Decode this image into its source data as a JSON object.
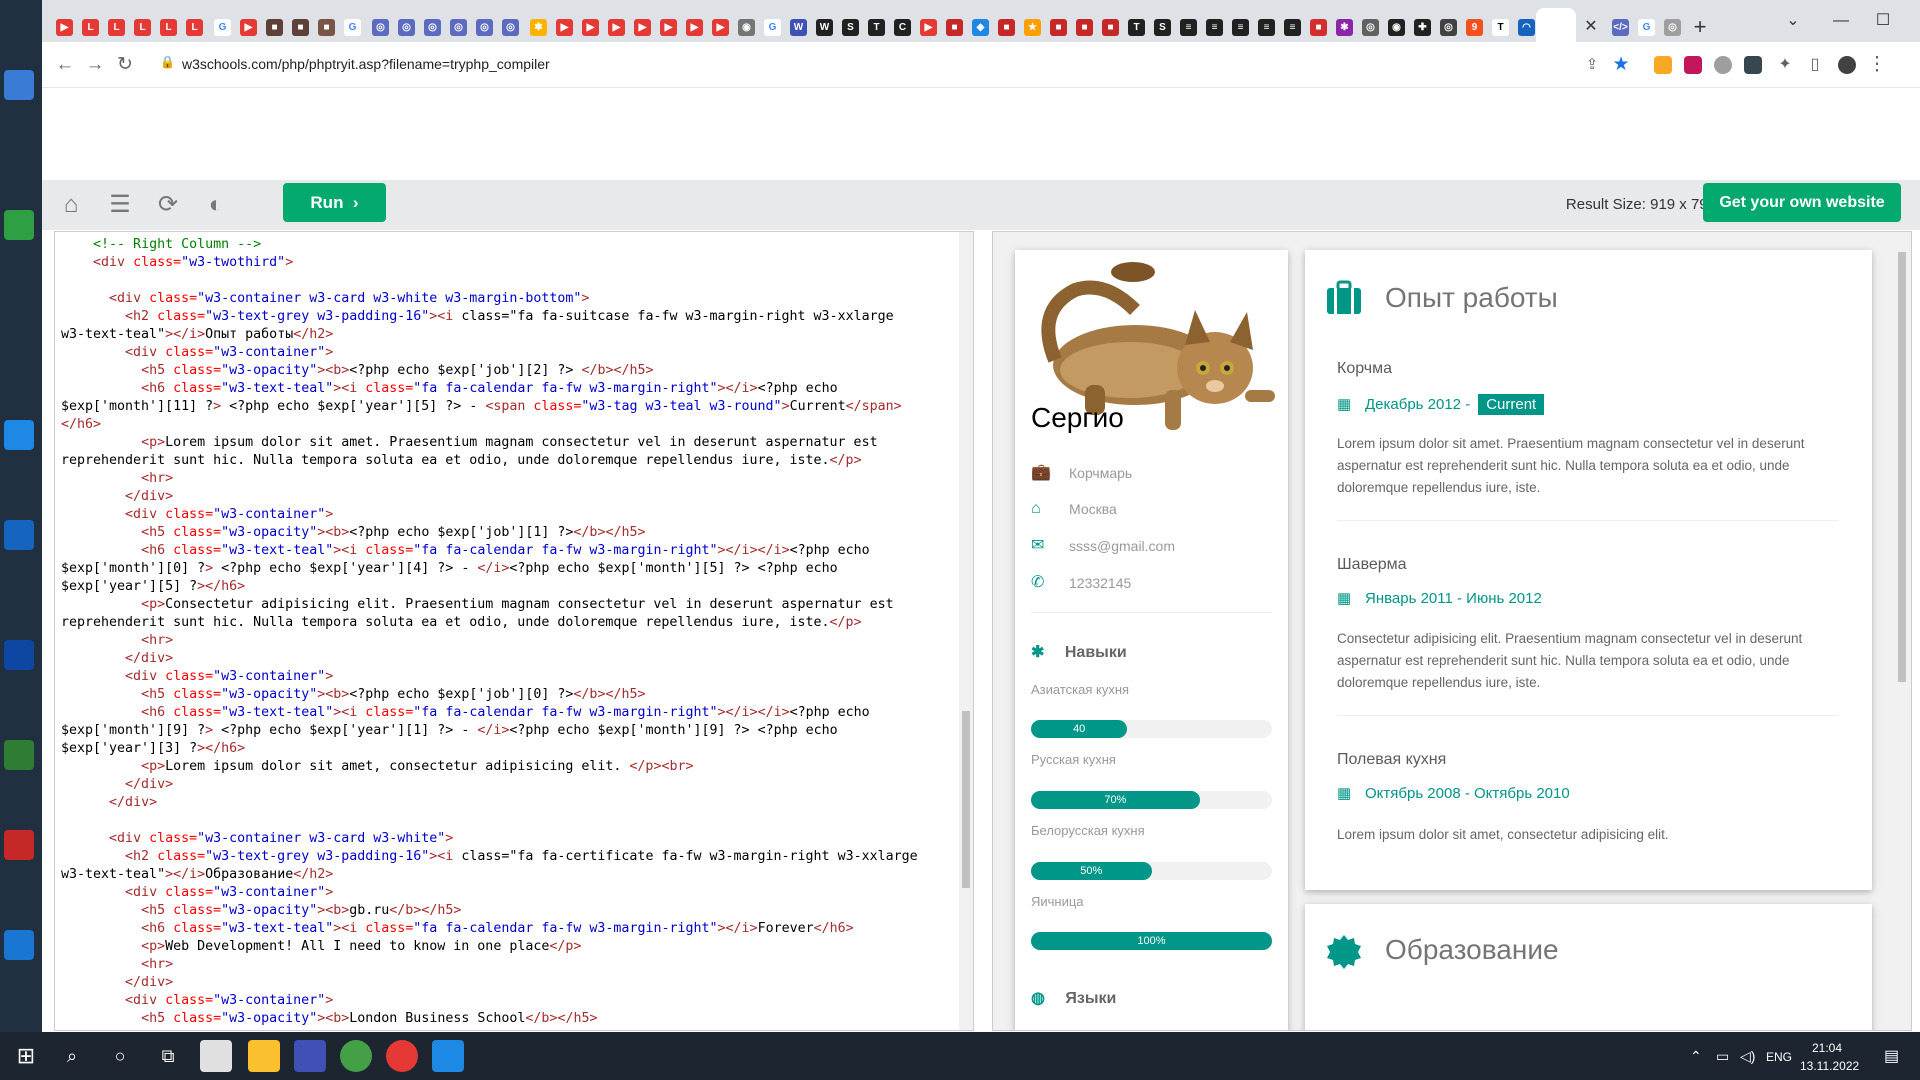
{
  "browser": {
    "url": "w3schools.com/php/phptryit.asp?filename=tryphp_compiler",
    "tab_close": "✕",
    "new_tab": "+"
  },
  "tryit": {
    "run_label": "Run",
    "result_size": "Result Size: 919 x 797",
    "own_site": "Get your own website"
  },
  "code_lines": [
    "    <!-- Right Column -->",
    "    <div class=\"w3-twothird\">",
    "",
    "      <div class=\"w3-container w3-card w3-white w3-margin-bottom\">",
    "        <h2 class=\"w3-text-grey w3-padding-16\"><i class=\"fa fa-suitcase fa-fw w3-margin-right w3-xxlarge",
    "w3-text-teal\"></i>Опыт работы</h2>",
    "        <div class=\"w3-container\">",
    "          <h5 class=\"w3-opacity\"><b><?php echo $exp['job'][2] ?> </b></h5>",
    "          <h6 class=\"w3-text-teal\"><i class=\"fa fa-calendar fa-fw w3-margin-right\"></i><?php echo",
    "$exp['month'][11] ?> <?php echo $exp['year'][5] ?> - <span class=\"w3-tag w3-teal w3-round\">Current</span>",
    "</h6>",
    "          <p>Lorem ipsum dolor sit amet. Praesentium magnam consectetur vel in deserunt aspernatur est",
    "reprehenderit sunt hic. Nulla tempora soluta ea et odio, unde doloremque repellendus iure, iste.</p>",
    "          <hr>",
    "        </div>",
    "        <div class=\"w3-container\">",
    "          <h5 class=\"w3-opacity\"><b><?php echo $exp['job'][1] ?></b></h5>",
    "          <h6 class=\"w3-text-teal\"><i class=\"fa fa-calendar fa-fw w3-margin-right\"></i></i><?php echo",
    "$exp['month'][0] ?> <?php echo $exp['year'][4] ?> - </i><?php echo $exp['month'][5] ?> <?php echo",
    "$exp['year'][5] ?></h6>",
    "          <p>Consectetur adipisicing elit. Praesentium magnam consectetur vel in deserunt aspernatur est",
    "reprehenderit sunt hic. Nulla tempora soluta ea et odio, unde doloremque repellendus iure, iste.</p>",
    "          <hr>",
    "        </div>",
    "        <div class=\"w3-container\">",
    "          <h5 class=\"w3-opacity\"><b><?php echo $exp['job'][0] ?></b></h5>",
    "          <h6 class=\"w3-text-teal\"><i class=\"fa fa-calendar fa-fw w3-margin-right\"></i></i><?php echo",
    "$exp['month'][9] ?> <?php echo $exp['year'][1] ?> - </i><?php echo $exp['month'][9] ?> <?php echo",
    "$exp['year'][3] ?></h6>",
    "          <p>Lorem ipsum dolor sit amet, consectetur adipisicing elit. </p><br>",
    "        </div>",
    "      </div>",
    "",
    "      <div class=\"w3-container w3-card w3-white\">",
    "        <h2 class=\"w3-text-grey w3-padding-16\"><i class=\"fa fa-certificate fa-fw w3-margin-right w3-xxlarge",
    "w3-text-teal\"></i>Образование</h2>",
    "        <div class=\"w3-container\">",
    "          <h5 class=\"w3-opacity\"><b>gb.ru</b></h5>",
    "          <h6 class=\"w3-text-teal\"><i class=\"fa fa-calendar fa-fw w3-margin-right\"></i>Forever</h6>",
    "          <p>Web Development! All I need to know in one place</p>",
    "          <hr>",
    "        </div>",
    "        <div class=\"w3-container\">",
    "          <h5 class=\"w3-opacity\"><b>London Business School</b></h5>"
  ],
  "profile": {
    "name": "Сергио",
    "job": "Корчмарь",
    "city": "Москва",
    "email": "ssss@gmail.com",
    "phone": "12332145",
    "skills_heading": "Навыки",
    "languages_heading": "Языки",
    "skills": [
      {
        "label": "Азиатская кухня",
        "value": "40",
        "fraction": 0.4
      },
      {
        "label": "Русская кухня",
        "value": "70%",
        "fraction": 0.7
      },
      {
        "label": "Белорусская кухня",
        "value": "50%",
        "fraction": 0.5
      },
      {
        "label": "Яичница",
        "value": "100%",
        "fraction": 1.0
      }
    ]
  },
  "experience": {
    "heading": "Опыт работы",
    "jobs": [
      {
        "title": "Корчма",
        "date": "Декабрь 2012 -",
        "tag": "Current",
        "text": "Lorem ipsum dolor sit amet. Praesentium magnam consectetur vel in deserunt aspernatur est reprehenderit sunt hic. Nulla tempora soluta ea et odio, unde doloremque repellendus iure, iste."
      },
      {
        "title": "Шаверма",
        "date": "Январь 2011 - Июнь 2012",
        "tag": "",
        "text": "Consectetur adipisicing elit. Praesentium magnam consectetur vel in deserunt aspernatur est reprehenderit sunt hic. Nulla tempora soluta ea et odio, unde doloremque repellendus iure, iste."
      },
      {
        "title": "Полевая кухня",
        "date": "Октябрь 2008 - Октябрь 2010",
        "tag": "",
        "text": "Lorem ipsum dolor sit amet, consectetur adipisicing elit."
      }
    ]
  },
  "education": {
    "heading": "Образование"
  },
  "taskbar": {
    "lang": "ENG",
    "time": "21:04",
    "date": "13.11.2022"
  },
  "colors": {
    "teal": "#009688",
    "w3green": "#04aa6d"
  }
}
